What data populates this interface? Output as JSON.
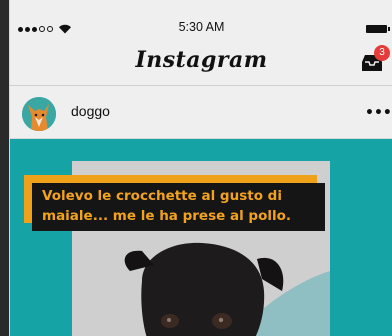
{
  "status_bar": {
    "time": "5:30 AM"
  },
  "nav": {
    "title": "Instagram",
    "inbox_badge_count": "3"
  },
  "post": {
    "username": "doggo",
    "more_label": "•••",
    "caption_line_1": "Volevo le crocchette al gusto di",
    "caption_line_2": "maiale... me le ha prese al pollo."
  },
  "colors": {
    "post_background": "#16a3a6",
    "caption_text": "#f2a21d",
    "caption_box": "#151515",
    "badge": "#e53b3b"
  }
}
